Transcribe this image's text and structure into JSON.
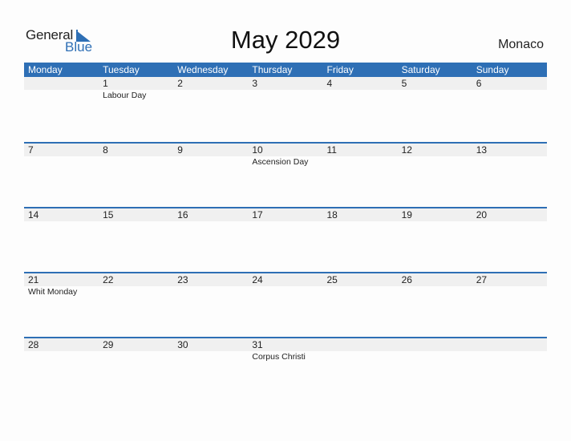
{
  "logo": {
    "word1": "General",
    "word2": "Blue"
  },
  "title": "May 2029",
  "country": "Monaco",
  "colors": {
    "accent": "#2e6fb5",
    "band": "#f0f0f0"
  },
  "weekdays": [
    "Monday",
    "Tuesday",
    "Wednesday",
    "Thursday",
    "Friday",
    "Saturday",
    "Sunday"
  ],
  "weeks": [
    [
      {
        "day": ""
      },
      {
        "day": "1",
        "holiday": "Labour Day"
      },
      {
        "day": "2"
      },
      {
        "day": "3"
      },
      {
        "day": "4"
      },
      {
        "day": "5"
      },
      {
        "day": "6"
      }
    ],
    [
      {
        "day": "7"
      },
      {
        "day": "8"
      },
      {
        "day": "9"
      },
      {
        "day": "10",
        "holiday": "Ascension Day"
      },
      {
        "day": "11"
      },
      {
        "day": "12"
      },
      {
        "day": "13"
      }
    ],
    [
      {
        "day": "14"
      },
      {
        "day": "15"
      },
      {
        "day": "16"
      },
      {
        "day": "17"
      },
      {
        "day": "18"
      },
      {
        "day": "19"
      },
      {
        "day": "20"
      }
    ],
    [
      {
        "day": "21",
        "holiday": "Whit Monday"
      },
      {
        "day": "22"
      },
      {
        "day": "23"
      },
      {
        "day": "24"
      },
      {
        "day": "25"
      },
      {
        "day": "26"
      },
      {
        "day": "27"
      }
    ],
    [
      {
        "day": "28"
      },
      {
        "day": "29"
      },
      {
        "day": "30"
      },
      {
        "day": "31",
        "holiday": "Corpus Christi"
      },
      {
        "day": ""
      },
      {
        "day": ""
      },
      {
        "day": ""
      }
    ]
  ]
}
